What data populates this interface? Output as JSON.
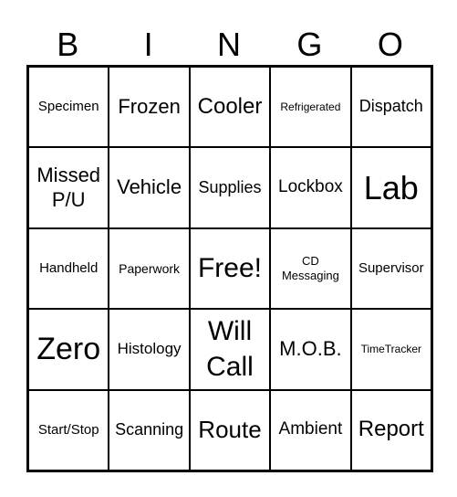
{
  "header": [
    "B",
    "I",
    "N",
    "G",
    "O"
  ],
  "cells": [
    "Specimen",
    "Frozen",
    "Cooler",
    "Refrigerated",
    "Dispatch",
    "Missed P/U",
    "Vehicle",
    "Supplies",
    "Lockbox",
    "Lab",
    "Handheld",
    "Paperwork",
    "Free!",
    "CD Messaging",
    "Supervisor",
    "Zero",
    "Histology",
    "Will Call",
    "M.O.B.",
    "TimeTracker",
    "Start/Stop",
    "Scanning",
    "Route",
    "Ambient",
    "Report"
  ]
}
